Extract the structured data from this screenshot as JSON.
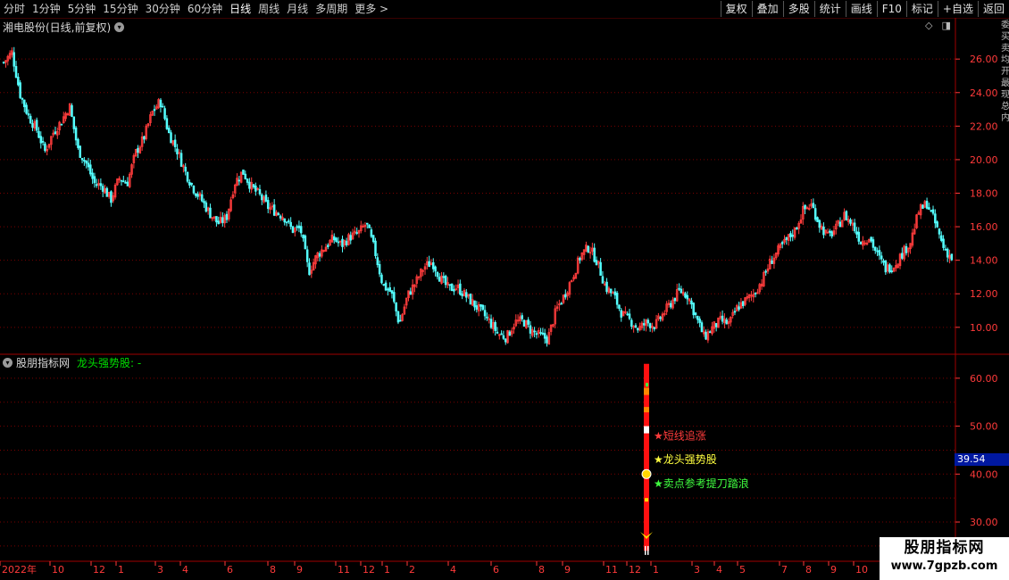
{
  "toolbar": {
    "periods": [
      "分时",
      "1分钟",
      "5分钟",
      "15分钟",
      "30分钟",
      "60分钟",
      "日线",
      "周线",
      "月线",
      "多周期",
      "更多 >"
    ],
    "active_period": "日线",
    "buttons": [
      "复权",
      "叠加",
      "多股",
      "统计",
      "画线",
      "F10",
      "标记",
      "+自选",
      "返回"
    ]
  },
  "main_panel": {
    "title": "湘电股份(日线,前复权)",
    "y_ticks": [
      "26.00",
      "24.00",
      "22.00",
      "20.00",
      "18.00",
      "16.00",
      "14.00",
      "12.00",
      "10.00"
    ],
    "colors": {
      "up": "#ff3c3c",
      "down": "#54ffff",
      "grid": "#7a0000",
      "axis": "#ff3a3a"
    }
  },
  "sub_panel": {
    "source": "股朋指标网",
    "indicator": "龙头强势股: -",
    "y_ticks": [
      "60.00",
      "50.00",
      "40.00",
      "30.00"
    ],
    "current_value": "39.54",
    "signals": [
      {
        "text": "★短线追涨",
        "color": "#ff3c3c"
      },
      {
        "text": "★龙头强势股",
        "color": "#ffff40"
      },
      {
        "text": "★卖点参考提刀踏浪",
        "color": "#40ff40"
      }
    ]
  },
  "date_axis": [
    "2022年",
    "10",
    "12",
    "1",
    "3",
    "4",
    "6",
    "8",
    "9",
    "11",
    "12",
    "1",
    "2",
    "4",
    "6",
    "8",
    "9",
    "11",
    "12",
    "1",
    "3",
    "4",
    "5",
    "7",
    "8",
    "9",
    "10"
  ],
  "right_strip": "委买卖均开最现总内",
  "watermark": {
    "line1": "股朋指标网",
    "line2": "www.7gpzb.com"
  },
  "chart_data": {
    "type": "candlestick",
    "title": "湘电股份(日线,前复权)",
    "ylim": [
      8.5,
      27.5
    ],
    "y_ticks": [
      26,
      24,
      22,
      20,
      18,
      16,
      14,
      12,
      10
    ],
    "x_ticks": [
      "2022年",
      "10",
      "12",
      "1",
      "3",
      "4",
      "6",
      "8",
      "9",
      "11",
      "12",
      "1",
      "2",
      "4",
      "6",
      "8",
      "9",
      "11",
      "12",
      "1",
      "3",
      "4",
      "5",
      "7",
      "8",
      "9",
      "10"
    ],
    "close_path_approx": [
      25.8,
      26.4,
      23.9,
      22.6,
      21.8,
      20.5,
      21.6,
      22.3,
      23.2,
      20.6,
      19.8,
      18.6,
      18.4,
      17.6,
      18.9,
      18.6,
      20.4,
      21.3,
      22.8,
      23.5,
      21.6,
      20.6,
      19.3,
      18.3,
      17.6,
      16.8,
      16.2,
      16.5,
      18.6,
      19.3,
      18.4,
      17.9,
      17.2,
      16.9,
      16.6,
      15.8,
      15.9,
      13.3,
      14.3,
      14.8,
      15.3,
      14.9,
      15.4,
      15.6,
      16.2,
      14.6,
      12.5,
      12.1,
      10.2,
      11.9,
      12.7,
      13.6,
      13.9,
      12.9,
      12.3,
      12.4,
      11.9,
      11.4,
      10.9,
      10.3,
      9.6,
      9.4,
      10.3,
      10.4,
      9.8,
      9.5,
      9.3,
      11.0,
      11.9,
      13.0,
      14.3,
      14.8,
      13.9,
      12.4,
      11.9,
      10.8,
      10.4,
      9.9,
      10.3,
      10.1,
      10.8,
      11.5,
      12.2,
      11.9,
      10.6,
      9.4,
      10.0,
      10.4,
      10.2,
      11.2,
      11.6,
      12.0,
      12.8,
      13.9,
      14.6,
      15.2,
      15.8,
      17.0,
      17.3,
      16.1,
      15.4,
      15.9,
      16.7,
      16.1,
      15.1,
      15.4,
      14.3,
      13.5,
      13.7,
      14.4,
      15.1,
      16.9,
      17.4,
      16.2,
      14.8,
      14.1
    ],
    "sub_indicator": {
      "name": "龙头强势股",
      "ylim": [
        22,
        65
      ],
      "y_ticks": [
        60,
        50,
        40,
        30
      ],
      "current": 39.54
    }
  }
}
